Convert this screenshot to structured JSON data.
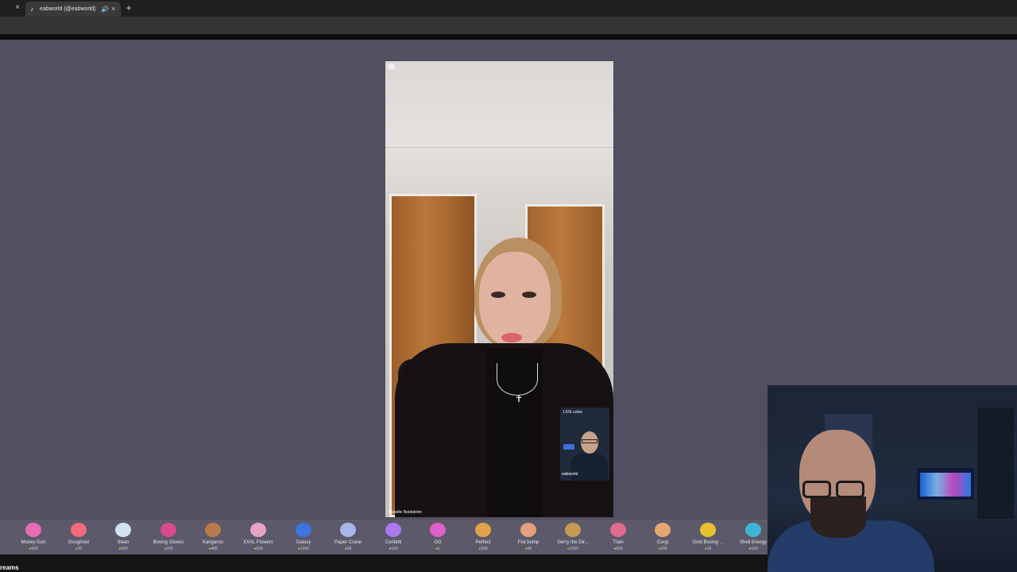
{
  "browser": {
    "tab_title": "eabworld (@eabworld) is LIVE",
    "new_tab_symbol": "+",
    "close_symbol": "×",
    "audio_symbol": "🔊",
    "favicon_symbol": "♪"
  },
  "live": {
    "host_name": "Isabelle Nordström",
    "guest_label": "LIVE coins",
    "guest_name": "eabworld"
  },
  "gifts": [
    {
      "name": "Money Gun",
      "price": "500",
      "icon": "money-gun-icon",
      "color": "#e86bb5"
    },
    {
      "name": "Doughnut",
      "price": "30",
      "icon": "doughnut-icon",
      "color": "#f06a7a"
    },
    {
      "name": "Swan",
      "price": "699",
      "icon": "swan-icon",
      "color": "#cfe3f2"
    },
    {
      "name": "Boxing Gloves",
      "price": "299",
      "icon": "boxing-gloves-icon",
      "color": "#d94b8c"
    },
    {
      "name": "Kangaroo",
      "price": "488",
      "icon": "kangaroo-icon",
      "color": "#b77a4a"
    },
    {
      "name": "XXXL Flowers",
      "price": "500",
      "icon": "flowers-icon",
      "color": "#e8a3c3"
    },
    {
      "name": "Galaxy",
      "price": "1000",
      "icon": "galaxy-icon",
      "color": "#3f73e0"
    },
    {
      "name": "Paper Crane",
      "price": "99",
      "icon": "paper-crane-icon",
      "color": "#a6b6ea"
    },
    {
      "name": "Confetti",
      "price": "100",
      "icon": "confetti-icon",
      "color": "#a879e8"
    },
    {
      "name": "GG",
      "price": "1",
      "icon": "gg-icon",
      "color": "#e060c9"
    },
    {
      "name": "Perfect",
      "price": "299",
      "icon": "perfect-icon",
      "color": "#e0a24a"
    },
    {
      "name": "Fist bump",
      "price": "90",
      "icon": "fist-bump-icon",
      "color": "#e3a07a"
    },
    {
      "name": "Gerry the Gir...",
      "price": "1000",
      "icon": "giraffe-icon",
      "color": "#c79a55"
    },
    {
      "name": "Train",
      "price": "899",
      "icon": "train-icon",
      "color": "#e16a8d"
    },
    {
      "name": "Corgi",
      "price": "299",
      "icon": "corgi-icon",
      "color": "#e7a56f"
    },
    {
      "name": "Gold Boxing ...",
      "price": "10",
      "icon": "gold-boxing-icon",
      "color": "#e8c22e"
    },
    {
      "name": "Shell Energy",
      "price": "100",
      "icon": "shell-energy-icon",
      "color": "#3fb3d6"
    }
  ],
  "bottom_text": "reams"
}
